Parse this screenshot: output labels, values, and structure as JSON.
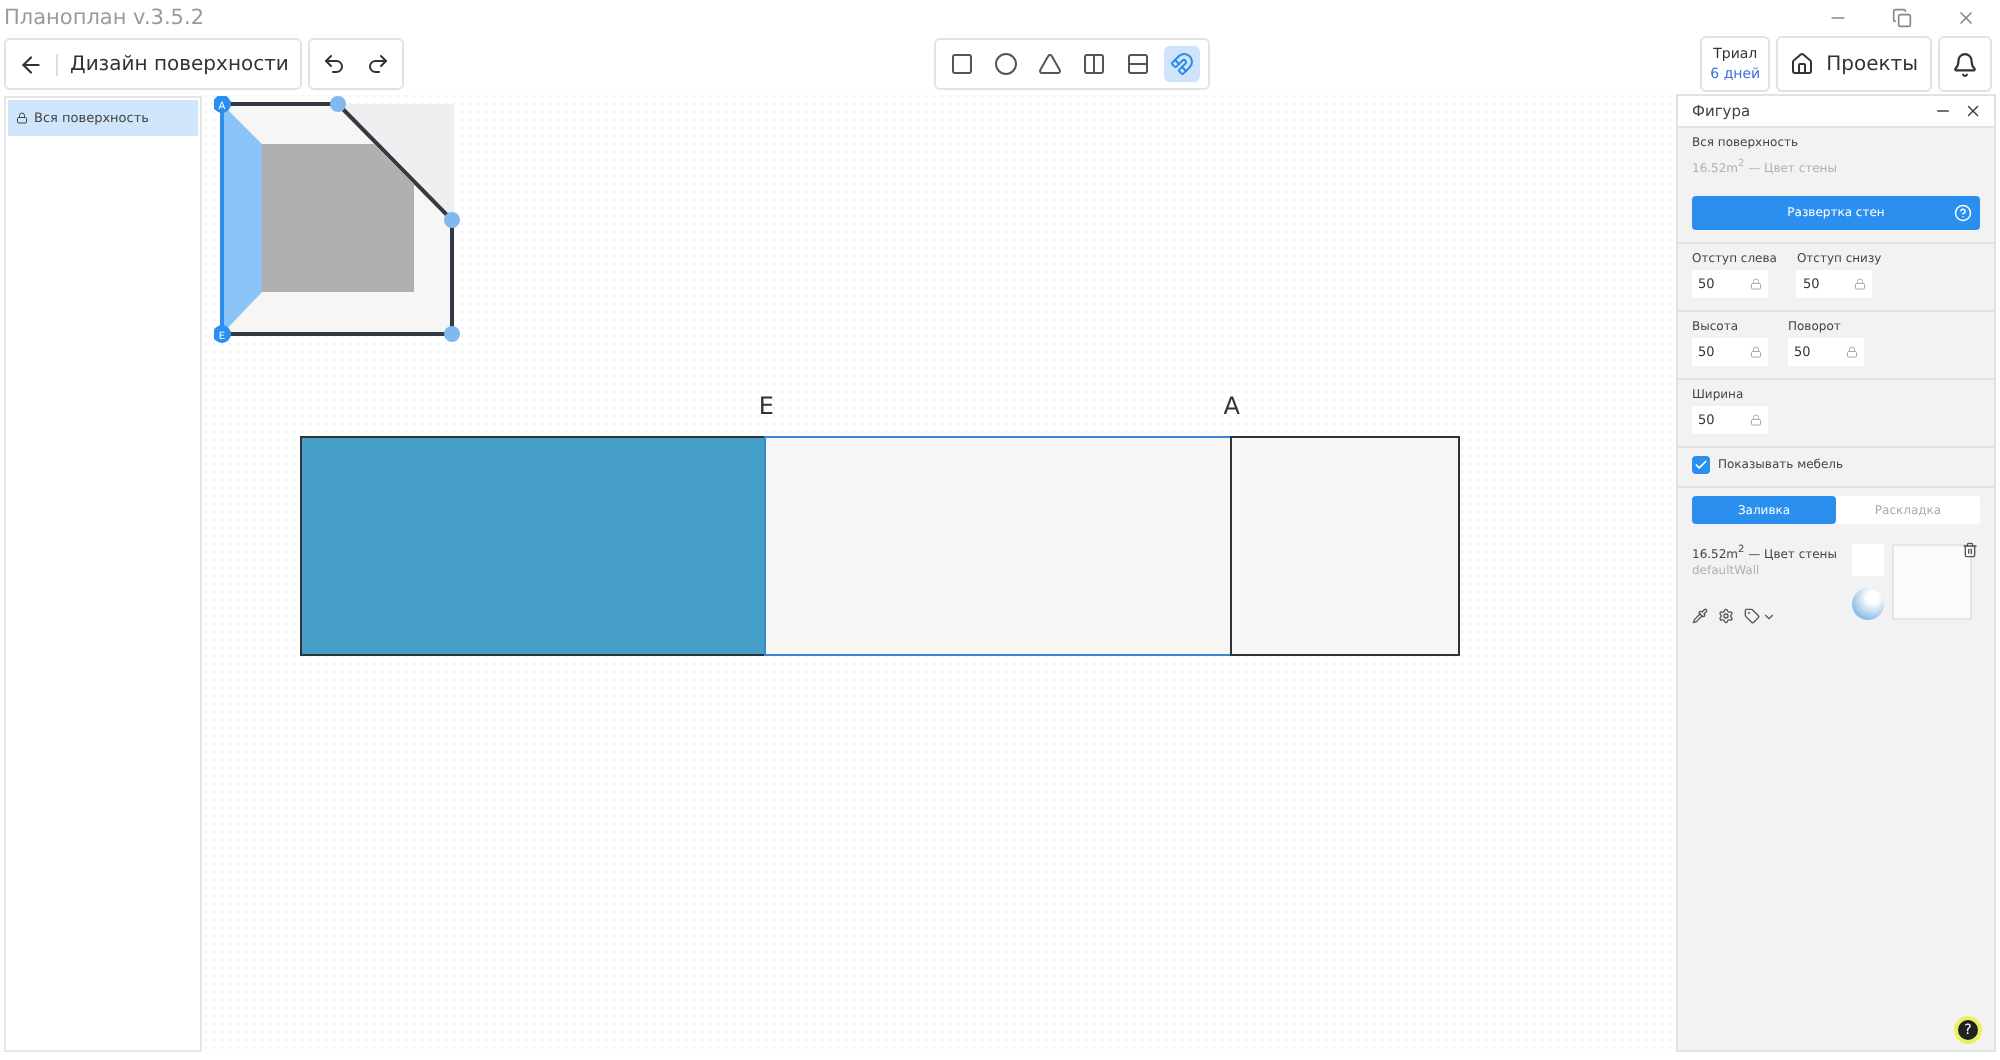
{
  "window": {
    "title": "Планоплан v.3.5.2"
  },
  "header": {
    "page_title": "Дизайн поверхности",
    "tools": [
      {
        "kind": "rectangle",
        "selected": false
      },
      {
        "kind": "circle",
        "selected": false
      },
      {
        "kind": "triangle",
        "selected": false
      },
      {
        "kind": "vertical",
        "selected": false
      },
      {
        "kind": "horizontal",
        "selected": false
      },
      {
        "kind": "magnet",
        "selected": true
      }
    ],
    "trial": {
      "label": "Триал",
      "days": "6 дней"
    },
    "projects": "Проекты"
  },
  "sidebar": {
    "items": [
      {
        "label": "Вся поверхность",
        "selected": true
      }
    ]
  },
  "minimap": {
    "corner_labels": [
      "A",
      "E"
    ]
  },
  "wall": {
    "segments": [
      {
        "color": "#459fc9",
        "selected": false,
        "label": "E"
      },
      {
        "color": "#f6f6f5",
        "selected": true,
        "label": "A"
      },
      {
        "color": "#f6f6f5",
        "selected": false
      }
    ]
  },
  "panel": {
    "title": "Фигура",
    "surface": "Вся поверхность",
    "area": "16.52m$^{2}$ — Цвет стены",
    "unfold_button": "Развертка стен",
    "field_groups": [
      [
        {
          "label": "Отступ слева",
          "value": "50"
        },
        {
          "label": "Отступ снизу",
          "value": "50"
        }
      ],
      [
        {
          "label": "Высота",
          "value": "50"
        },
        {
          "label": "Поворот",
          "value": "50"
        }
      ],
      [
        {
          "label": "Ширина",
          "value": "50"
        }
      ]
    ],
    "show_furniture": {
      "label": "Показывать мебель",
      "checked": true
    },
    "tabs": [
      {
        "label": "Заливка",
        "selected": true
      },
      {
        "label": "Раскладка",
        "selected": false
      }
    ],
    "material": {
      "title": "16.52m$^{2}$ — Цвет стены",
      "name": "defaultWall"
    }
  },
  "help_button": "?"
}
